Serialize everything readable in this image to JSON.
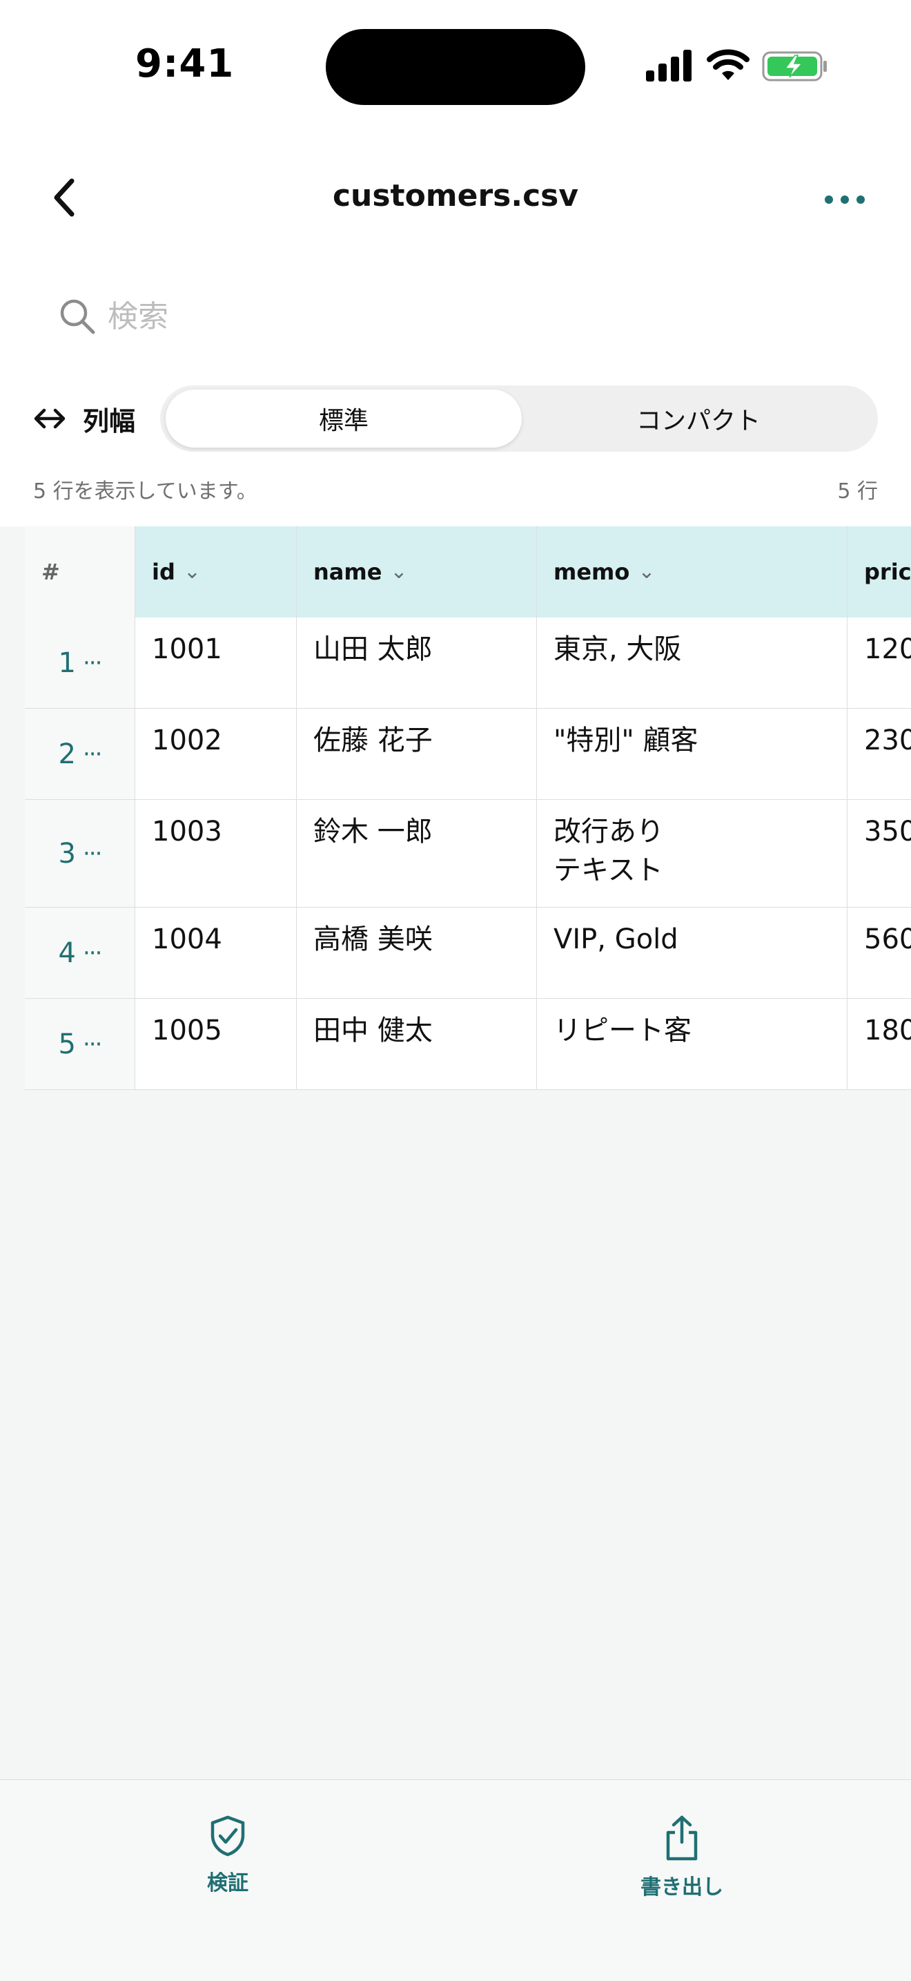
{
  "status": {
    "time": "9:41"
  },
  "nav": {
    "title": "customers.csv"
  },
  "search": {
    "placeholder": "検索"
  },
  "column_width": {
    "label": "列幅",
    "options": [
      "標準",
      "コンパクト"
    ],
    "selected": "標準"
  },
  "info": {
    "left": "5 行を表示しています。",
    "right": "5 行"
  },
  "table": {
    "headers": {
      "num": "#",
      "id": "id",
      "name": "name",
      "memo": "memo",
      "price": "pric"
    },
    "rows": [
      {
        "num": "1",
        "id": "1001",
        "name": "山田 太郎",
        "memo": "東京, 大阪",
        "price": "120"
      },
      {
        "num": "2",
        "id": "1002",
        "name": "佐藤 花子",
        "memo": "\"特別\" 顧客",
        "price": "230"
      },
      {
        "num": "3",
        "id": "1003",
        "name": "鈴木 一郎",
        "memo": "改行あり\nテキスト",
        "price": "350"
      },
      {
        "num": "4",
        "id": "1004",
        "name": "高橋 美咲",
        "memo": "VIP, Gold",
        "price": "560"
      },
      {
        "num": "5",
        "id": "1005",
        "name": "田中 健太",
        "memo": "リピート客",
        "price": "180"
      }
    ]
  },
  "tabs": {
    "verify": "検証",
    "export": "書き出し"
  },
  "colors": {
    "accent": "#1f6f73",
    "header_bg": "#d6f0f2",
    "battery": "#34c759"
  },
  "icons": {
    "back": "chevron-left-icon",
    "more": "ellipsis-icon",
    "search": "search-icon",
    "colwidth": "left-right-arrow-icon",
    "verify": "shield-check-icon",
    "export": "share-icon"
  }
}
